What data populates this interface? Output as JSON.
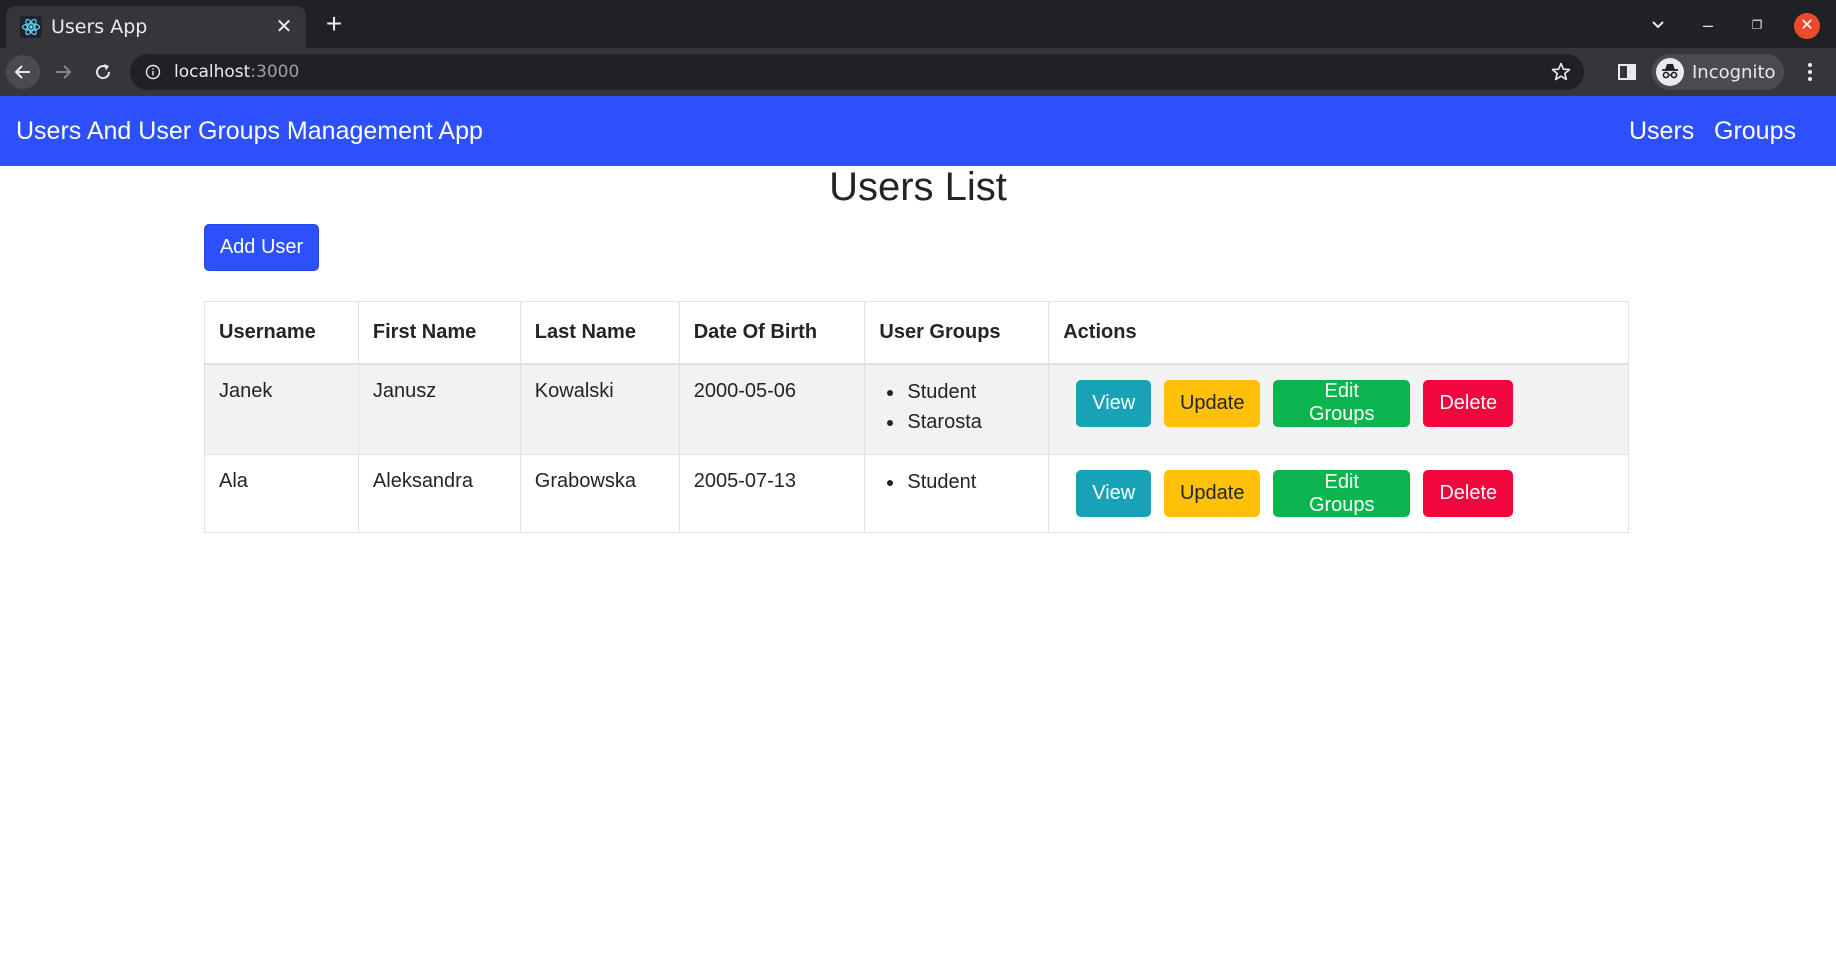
{
  "browser": {
    "tab_title": "Users App",
    "tab_close": "✕",
    "new_tab": "+",
    "url_host": "localhost",
    "url_port": ":3000",
    "profile_label": "Incognito",
    "win_close": "✕",
    "win_min": "–",
    "win_max": "❐"
  },
  "app": {
    "brand": "Users And User Groups Management App",
    "nav": {
      "users": "Users",
      "groups": "Groups"
    },
    "page_title": "Users List",
    "add_user_label": "Add User",
    "accent_color": "#2b50fc"
  },
  "table": {
    "headers": [
      "Username",
      "First Name",
      "Last Name",
      "Date Of Birth",
      "User Groups",
      "Actions"
    ],
    "rows": [
      {
        "username": "Janek",
        "first_name": "Janusz",
        "last_name": "Kowalski",
        "dob": "2000-05-06",
        "groups": [
          "Student",
          "Starosta"
        ]
      },
      {
        "username": "Ala",
        "first_name": "Aleksandra",
        "last_name": "Grabowska",
        "dob": "2005-07-13",
        "groups": [
          "Student"
        ]
      }
    ],
    "actions": {
      "view": "View",
      "update": "Update",
      "edit_groups": "Edit Groups",
      "delete": "Delete"
    }
  }
}
